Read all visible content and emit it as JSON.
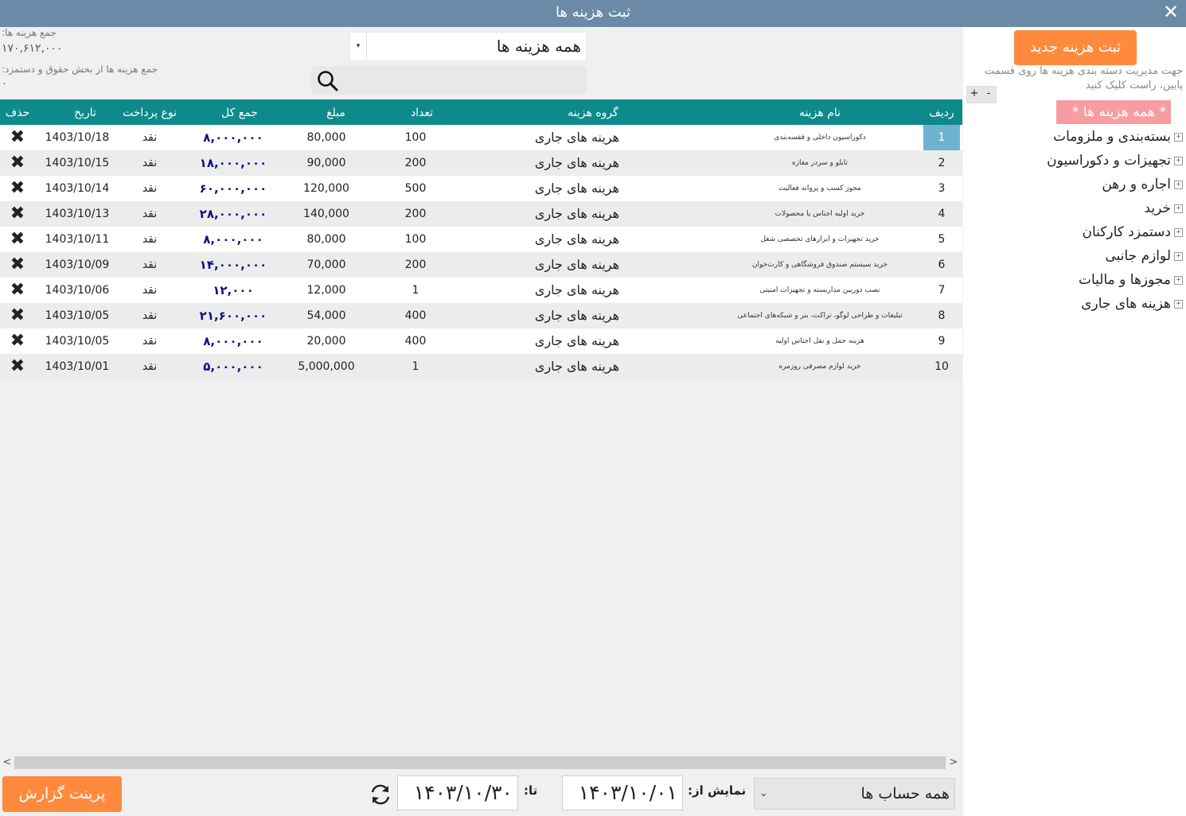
{
  "window": {
    "title": "ثبت هزینه ها",
    "close_label": "✕"
  },
  "summary": {
    "total_label": "جمع هزینه ها:",
    "total_value": "۱۷۰,۶۱۲,۰۰۰",
    "salary_label": "جمع هزینه ها از بخش حقوق و دستمزد:",
    "salary_value": "۰"
  },
  "filter": {
    "selected": "همه هزینه ها",
    "arrow": "▾"
  },
  "search": {
    "placeholder": "",
    "value": ""
  },
  "table": {
    "columns": [
      "ردیف",
      "نام هزینه",
      "گروه هزینه",
      "تعداد",
      "مبلغ",
      "جمع کل",
      "نوع پرداخت",
      "تاریخ",
      "حذف"
    ],
    "rows": [
      {
        "idx": "1",
        "name": "دکوراسیون داخلی و قفسه‌بندی",
        "group": "هرینه های جاری",
        "qty": "100",
        "price": "80,000",
        "total": "۸,۰۰۰,۰۰۰",
        "pay": "نقد",
        "date": "1403/10/18"
      },
      {
        "idx": "2",
        "name": "تابلو و سردر مغازه",
        "group": "هرینه های جاری",
        "qty": "200",
        "price": "90,000",
        "total": "۱۸,۰۰۰,۰۰۰",
        "pay": "نقد",
        "date": "1403/10/15"
      },
      {
        "idx": "3",
        "name": "مجوز کسب و پروانه فعالیت",
        "group": "هرینه های جاری",
        "qty": "500",
        "price": "120,000",
        "total": "۶۰,۰۰۰,۰۰۰",
        "pay": "نقد",
        "date": "1403/10/14"
      },
      {
        "idx": "4",
        "name": "خرید اولیه اجناس یا محصولات",
        "group": "هرینه های جاری",
        "qty": "200",
        "price": "140,000",
        "total": "۲۸,۰۰۰,۰۰۰",
        "pay": "نقد",
        "date": "1403/10/13"
      },
      {
        "idx": "5",
        "name": "خرید تجهیزات و ابزارهای تخصصی شغل",
        "group": "هرینه های جاری",
        "qty": "100",
        "price": "80,000",
        "total": "۸,۰۰۰,۰۰۰",
        "pay": "نقد",
        "date": "1403/10/11"
      },
      {
        "idx": "6",
        "name": "خرید سیستم صندوق فروشگاهی و کارت‌خوان",
        "group": "هرینه های جاری",
        "qty": "200",
        "price": "70,000",
        "total": "۱۴,۰۰۰,۰۰۰",
        "pay": "نقد",
        "date": "1403/10/09"
      },
      {
        "idx": "7",
        "name": "نصب دوربین مداربسته و تجهیزات امنیتی",
        "group": "هرینه های جاری",
        "qty": "1",
        "price": "12,000",
        "total": "۱۲,۰۰۰",
        "pay": "نقد",
        "date": "1403/10/06"
      },
      {
        "idx": "8",
        "name": "تبلیغات و طراحی لوگو، تراکت، بنر و شبکه‌های اجتماعی",
        "group": "هرینه های جاری",
        "qty": "400",
        "price": "54,000",
        "total": "۲۱,۶۰۰,۰۰۰",
        "pay": "نقد",
        "date": "1403/10/05"
      },
      {
        "idx": "9",
        "name": "هزینه حمل و نقل اجناس اولیه",
        "group": "هرینه های جاری",
        "qty": "400",
        "price": "20,000",
        "total": "۸,۰۰۰,۰۰۰",
        "pay": "نقد",
        "date": "1403/10/05"
      },
      {
        "idx": "10",
        "name": "خرید لوازم مصرفی روزمره",
        "group": "هرینه های جاری",
        "qty": "1",
        "price": "5,000,000",
        "total": "۵,۰۰۰,۰۰۰",
        "pay": "نقد",
        "date": "1403/10/01"
      }
    ],
    "delete_glyph": "✖"
  },
  "tree": {
    "new_button": "ثبت هزینه جدید",
    "hint": "جهت مدیریت دسته بندی هزینه ها روی قسمت پایین، راست کلیک کنید",
    "plus": "+",
    "minus": "-",
    "root": "* همه هزینه ها *",
    "expander": "+",
    "items": [
      "بسته‌بندی و ملزومات",
      "تجهیزات و دکوراسیون",
      "اجاره و رهن",
      "خرید",
      "دستمزد کارکنان",
      "لوازم جانبی",
      "مجوزها و مالیات",
      "هزینه های جاری"
    ]
  },
  "scrollbar": {
    "left": "<",
    "right": ">"
  },
  "footer": {
    "print_button": "پرینت گزارش",
    "to_label": "تا:",
    "to_date": "۱۴۰۳/۱۰/۳۰",
    "from_label": "نمایش از:",
    "from_date": "۱۴۰۳/۱۰/۰۱",
    "account": "همه حساب ها",
    "account_arrow": "⌄"
  },
  "colors": {
    "accent_orange": "#ff8a3d",
    "header_teal": "#0f8a8c",
    "title_bar": "#6a8aa8",
    "root_pink": "#f79da2",
    "selected_cell": "#6db3d0",
    "total_text": "#101080"
  },
  "icons": [
    "close-icon",
    "search-icon",
    "delete-icon",
    "expand-icon",
    "refresh-icon",
    "dropdown-arrow-icon"
  ]
}
